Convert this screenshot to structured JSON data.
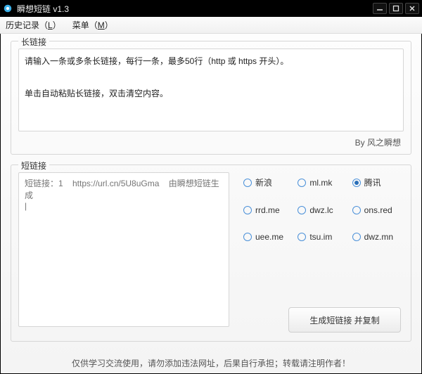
{
  "window": {
    "title": "瞬想短链 v1.3"
  },
  "menubar": {
    "history_label": "历史记录（",
    "history_key": "L",
    "history_suffix": "）",
    "menu_label": "菜单（",
    "menu_key": "M",
    "menu_suffix": "）"
  },
  "long": {
    "group_label": "长链接",
    "textarea_value": "请输入一条或多条长链接，每行一条，最多50行（http 或 https 开头）。\n\n单击自动粘贴长链接，双击清空内容。",
    "byline": "By 风之瞬想"
  },
  "short": {
    "group_label": "短链接",
    "placeholder": "短链接：1    https://url.cn/5U8uGma    由瞬想短链生成\n|",
    "services": [
      {
        "id": "sina",
        "label": "新浪",
        "selected": false
      },
      {
        "id": "mlmk",
        "label": "ml.mk",
        "selected": false
      },
      {
        "id": "tx",
        "label": "腾讯",
        "selected": true
      },
      {
        "id": "rrdme",
        "label": "rrd.me",
        "selected": false
      },
      {
        "id": "dwzlc",
        "label": "dwz.lc",
        "selected": false
      },
      {
        "id": "onsred",
        "label": "ons.red",
        "selected": false
      },
      {
        "id": "ueeme",
        "label": "uee.me",
        "selected": false
      },
      {
        "id": "tsuim",
        "label": "tsu.im",
        "selected": false
      },
      {
        "id": "dwzmn",
        "label": "dwz.mn",
        "selected": false
      }
    ],
    "generate_label": "生成短链接 并复制"
  },
  "footer": {
    "text": "仅供学习交流使用，请勿添加违法网址，后果自行承担；转载请注明作者！"
  }
}
